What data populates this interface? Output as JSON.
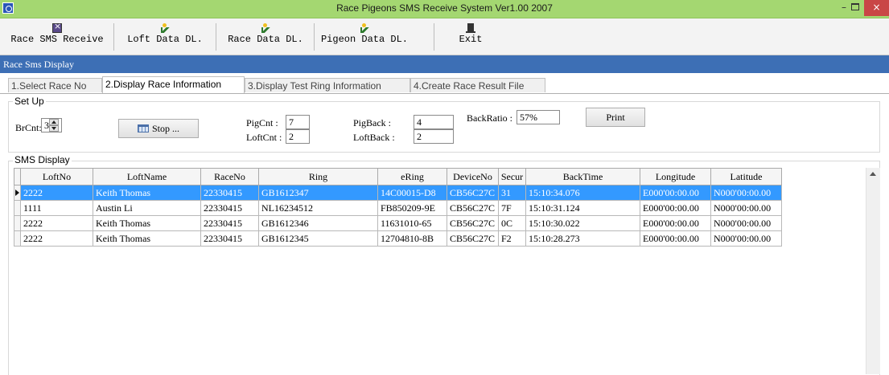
{
  "window": {
    "title": "Race Pigeons SMS Receive System Ver1.00 2007",
    "min_glyph": "–",
    "close_glyph": "×"
  },
  "toolbar": {
    "buttons": [
      {
        "label": "Race SMS Receive",
        "icon": "sms-icon"
      },
      {
        "label": "Loft Data DL.",
        "icon": "runner-icon"
      },
      {
        "label": "Race Data DL.",
        "icon": "runner-icon"
      },
      {
        "label": "Pigeon Data DL.",
        "icon": "runner-icon"
      },
      {
        "label": "Exit",
        "icon": "exit-icon"
      }
    ]
  },
  "section": {
    "title": "Race Sms Display"
  },
  "tabs": [
    {
      "label": "1.Select Race No",
      "active": false
    },
    {
      "label": "2.Display Race Information",
      "active": true
    },
    {
      "label": "3.Display Test Ring Information",
      "active": false
    },
    {
      "label": "4.Create Race Result File",
      "active": false
    }
  ],
  "setup": {
    "group_label": "Set Up",
    "brcnt_label": "BrCnt:",
    "brcnt_value": "3",
    "stop_label": "Stop ...",
    "pigcnt_label": "PigCnt :",
    "pigcnt_value": "7",
    "loftcnt_label": "LoftCnt :",
    "loftcnt_value": "2",
    "pigback_label": "PigBack :",
    "pigback_value": "4",
    "loftback_label": "LoftBack :",
    "loftback_value": "2",
    "backratio_label": "BackRatio :",
    "backratio_value": "57%",
    "print_label": "Print"
  },
  "sms": {
    "group_label": "SMS Display",
    "columns": [
      "LoftNo",
      "LoftName",
      "RaceNo",
      "Ring",
      "eRing",
      "DeviceNo",
      "Secur",
      "BackTime",
      "Longitude",
      "Latitude"
    ],
    "rows": [
      [
        "2222",
        "Keith Thomas",
        "22330415",
        "GB1612347",
        "14C00015-D8",
        "CB56C27C",
        "31",
        "15:10:34.076",
        "E000'00:00.00",
        "N000'00:00.00"
      ],
      [
        "1111",
        "Austin Li",
        "22330415",
        "NL16234512",
        "FB850209-9E",
        "CB56C27C",
        "7F",
        "15:10:31.124",
        "E000'00:00.00",
        "N000'00:00.00"
      ],
      [
        "2222",
        "Keith Thomas",
        "22330415",
        "GB1612346",
        "11631010-65",
        "CB56C27C",
        "0C",
        "15:10:30.022",
        "E000'00:00.00",
        "N000'00:00.00"
      ],
      [
        "2222",
        "Keith Thomas",
        "22330415",
        "GB1612345",
        "12704810-8B",
        "CB56C27C",
        "F2",
        "15:10:28.273",
        "E000'00:00.00",
        "N000'00:00.00"
      ]
    ],
    "selected_row": 0
  },
  "colors": {
    "titlebar": "#a4d771",
    "section_bar": "#3d6fb5",
    "selection": "#3399ff",
    "close_button": "#c94646"
  }
}
